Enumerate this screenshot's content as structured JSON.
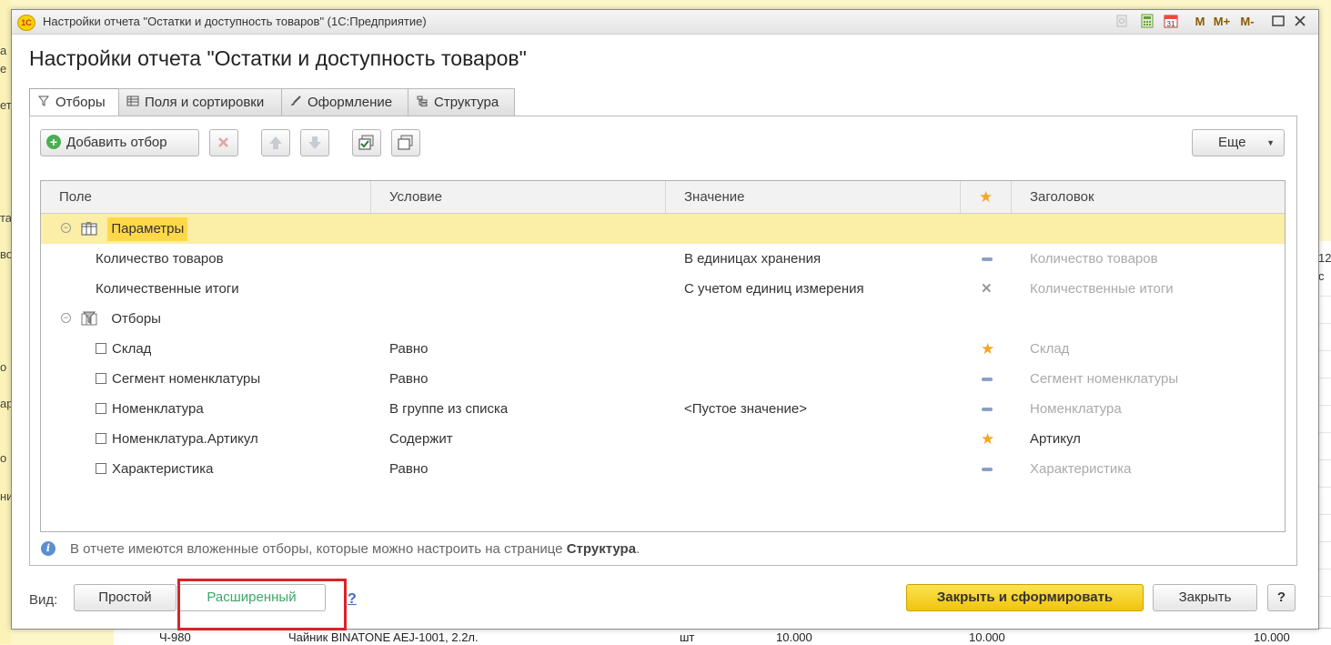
{
  "window": {
    "title": "Настройки отчета \"Остатки и доступность товаров\"  (1С:Предприятие)",
    "logo": "1С",
    "title_buttons": {
      "m": "M",
      "m_plus": "M+",
      "m_minus": "M-"
    }
  },
  "dialog_title": "Настройки отчета \"Остатки и доступность товаров\"",
  "tabs": [
    {
      "label": "Отборы",
      "icon": "filter-icon",
      "active": true
    },
    {
      "label": "Поля и сортировки",
      "icon": "fields-icon"
    },
    {
      "label": "Оформление",
      "icon": "brush-icon"
    },
    {
      "label": "Структура",
      "icon": "structure-icon"
    }
  ],
  "toolbar": {
    "add_filter": "Добавить отбор",
    "more": "Еще"
  },
  "grid": {
    "columns": [
      "Поле",
      "Условие",
      "Значение",
      "Заголовок"
    ],
    "groups": {
      "params": "Параметры",
      "filters": "Отборы"
    },
    "rows": [
      {
        "field": "Количество товаров",
        "condition": "",
        "value": "В единицах хранения",
        "title": "Количество товаров"
      },
      {
        "field": "Количественные итоги",
        "condition": "",
        "value": "С учетом единиц измерения",
        "title": "Количественные итоги"
      },
      {
        "field": "Склад",
        "condition": "Равно",
        "value": "",
        "title": "Склад"
      },
      {
        "field": "Сегмент номенклатуры",
        "condition": "Равно",
        "value": "",
        "title": "Сегмент номенклатуры"
      },
      {
        "field": "Номенклатура",
        "condition": "В группе из списка",
        "value": "<Пустое значение>",
        "title": "Номенклатура"
      },
      {
        "field": "Номенклатура.Артикул",
        "condition": "Содержит",
        "value": "",
        "title": "Артикул"
      },
      {
        "field": "Характеристика",
        "condition": "Равно",
        "value": "",
        "title": "Характеристика"
      }
    ]
  },
  "info": {
    "text": "В отчете имеются вложенные отборы, которые можно настроить на странице ",
    "link": "Структура",
    "end": "."
  },
  "bottom": {
    "view_label": "Вид:",
    "simple": "Простой",
    "extended": "Расширенный",
    "help": "?",
    "close_and_build": "Закрыть и сформировать",
    "close": "Закрыть",
    "help_button": "?"
  },
  "background": {
    "left_fragments": [
      "а",
      "е",
      "ет",
      "та",
      "во",
      "о",
      "ар",
      "о",
      "ни"
    ],
    "right_fragments": [
      "12",
      "с"
    ],
    "bottom_row": {
      "code": "Ч-980",
      "name": "Чайник BINATONE  AEJ-1001,  2.2л.",
      "unit": "шт",
      "q1": "10.000",
      "q2": "10.000",
      "q3": "10.000"
    }
  },
  "colors": {
    "accent_yellow": "#f1c40f",
    "selected_row": "#fbeea6",
    "highlight_frame": "#d9232a",
    "extended_text": "#3aa86b"
  }
}
